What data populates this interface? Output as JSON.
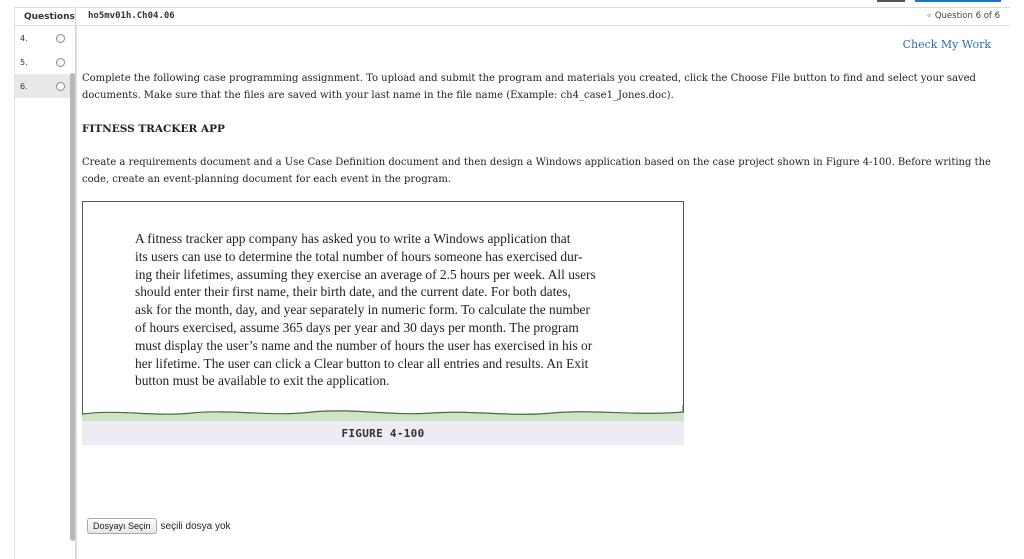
{
  "sidebar": {
    "title": "Questions",
    "items": [
      {
        "number": "4."
      },
      {
        "number": "5."
      },
      {
        "number": "6."
      }
    ]
  },
  "header": {
    "assignment_id": "ho5mv01h.Ch04.06",
    "question_nav": "Question 6 of 6"
  },
  "main": {
    "check_my_work": "Check My Work",
    "instructions": "Complete the following case programming assignment. To upload and submit the program and materials you created, click the Choose File button to find and select your saved documents. Make sure that the files are saved with your last name in the file name (Example: ch4_case1_Jones.doc).",
    "heading": "FITNESS TRACKER APP",
    "description": "Create a requirements document and a Use Case Definition document and then design a Windows application based on the case project shown in Figure 4-100. Before writing the code, create an event-planning document for each event in the program.",
    "figure": {
      "lines": [
        "A fitness tracker app company has asked you to write a Windows application that",
        "its users can use to determine the total number of hours someone has exercised dur-",
        "ing their lifetimes, assuming they exercise an average of 2.5 hours per week. All users",
        "should enter their first name, their birth date, and the current date. For both dates,",
        "ask for the month, day, and year separately in numeric form. To calculate the number",
        "of hours exercised, assume 365 days per year and 30 days per month. The program",
        "must display the user’s name and the number of hours the user has exercised in his or",
        "her lifetime. The user can click a Clear button to clear all entries and results. An Exit",
        "button must be available to exit the application."
      ],
      "caption": "FIGURE 4-100"
    },
    "file_input": {
      "button_label": "Dosyayı Seçin",
      "status": "seçili dosya yok"
    }
  }
}
